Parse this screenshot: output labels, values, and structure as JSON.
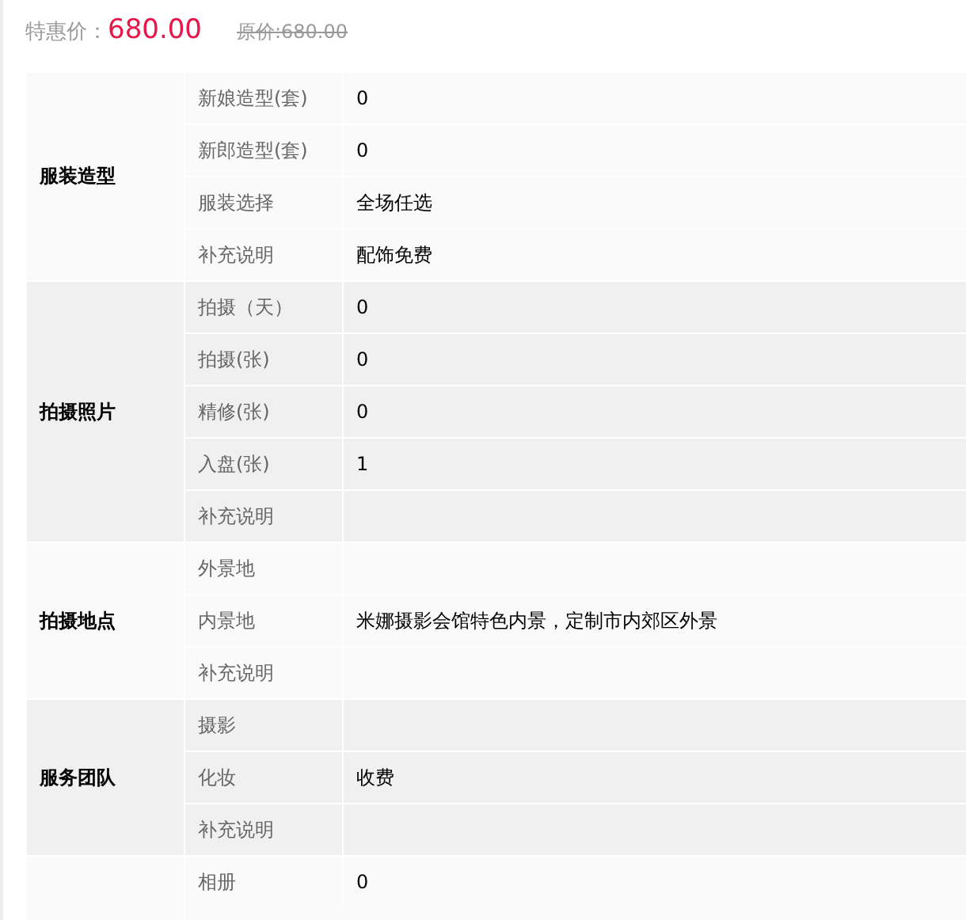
{
  "price": {
    "label": "特惠价：",
    "value": "680.00",
    "original": "原价:680.00"
  },
  "groups": [
    {
      "title": "服装造型",
      "rows": [
        {
          "label": "新娘造型(套)",
          "value": "0"
        },
        {
          "label": "新郎造型(套)",
          "value": "0"
        },
        {
          "label": "服装选择",
          "value": "全场任选"
        },
        {
          "label": "补充说明",
          "value": "配饰免费"
        }
      ]
    },
    {
      "title": "拍摄照片",
      "rows": [
        {
          "label": "拍摄（天）",
          "value": "0"
        },
        {
          "label": "拍摄(张)",
          "value": "0"
        },
        {
          "label": "精修(张)",
          "value": "0"
        },
        {
          "label": "入盘(张)",
          "value": "1"
        },
        {
          "label": "补充说明"
        }
      ]
    },
    {
      "title": "拍摄地点",
      "rows": [
        {
          "label": "外景地"
        },
        {
          "label": "内景地",
          "value": "米娜摄影会馆特色内景，定制市内郊区外景"
        },
        {
          "label": "补充说明"
        }
      ]
    },
    {
      "title": "服务团队",
      "rows": [
        {
          "label": "摄影"
        },
        {
          "label": "化妆",
          "value": "收费"
        },
        {
          "label": "补充说明"
        }
      ]
    },
    {
      "rows": [
        {
          "label": "相册",
          "value": "0"
        }
      ]
    }
  ]
}
